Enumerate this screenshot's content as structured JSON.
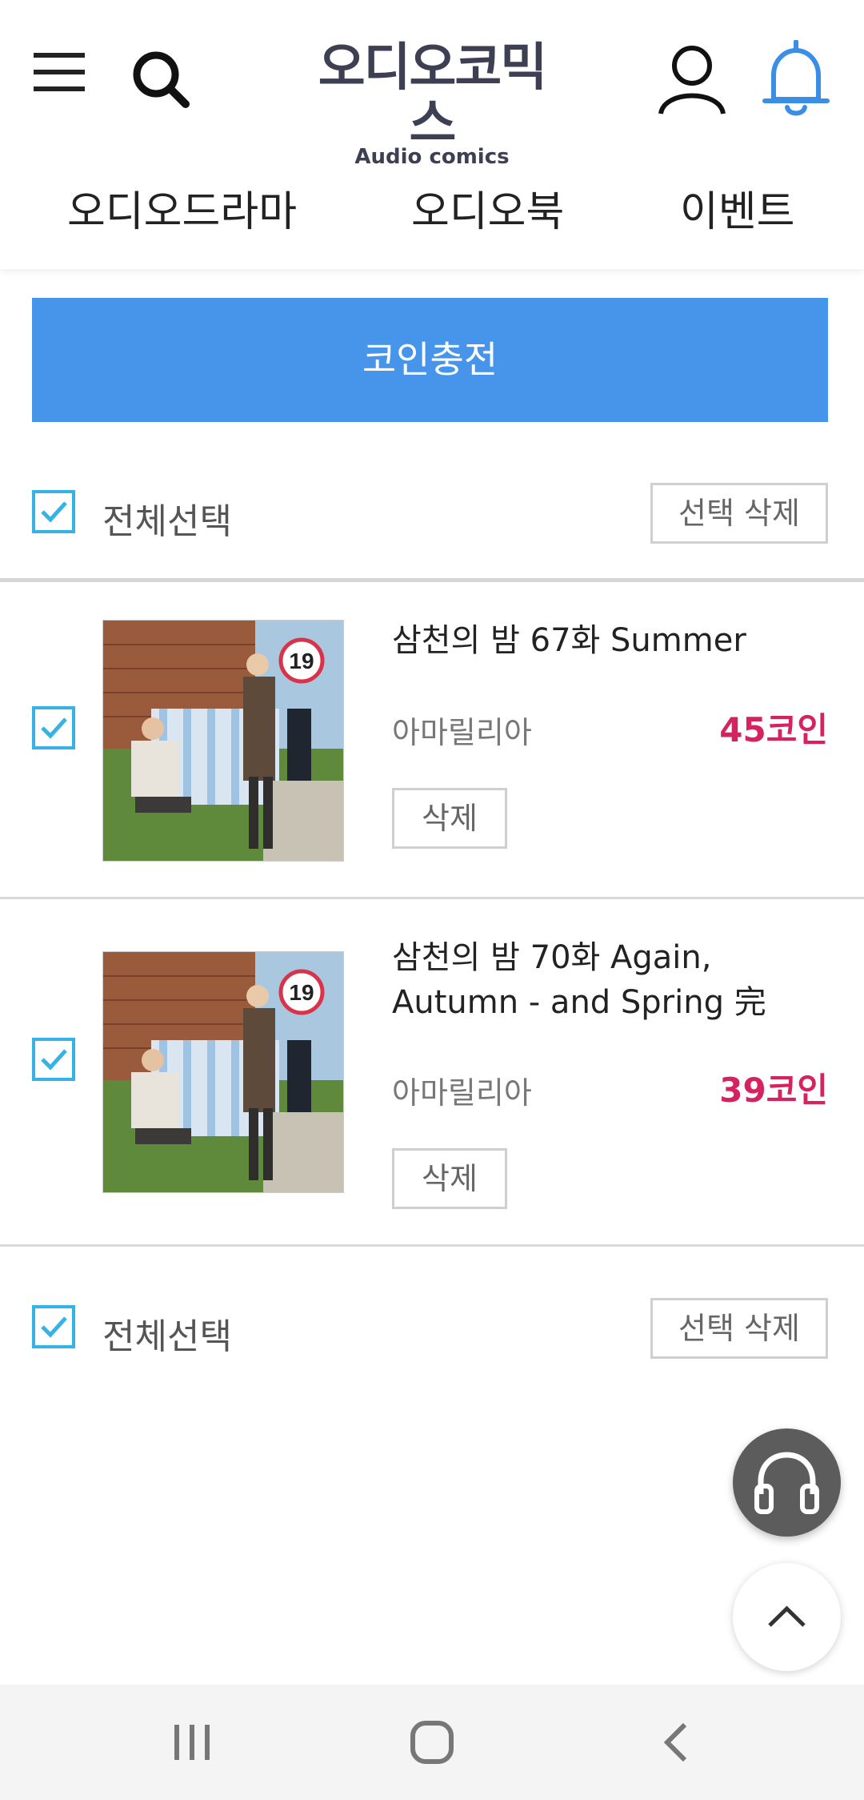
{
  "header": {
    "logo_main": "오디오코믹스",
    "logo_sub": "Audio comics",
    "tabs": [
      "오디오드라마",
      "오디오북",
      "이벤트"
    ]
  },
  "coin_button": "코인충전",
  "select_all": {
    "label": "전체선택",
    "delete_label": "선택 삭제"
  },
  "items": [
    {
      "title": "삼천의 밤 67화 Summer",
      "author": "아마릴리아",
      "price": "45코인",
      "delete": "삭제",
      "badge": "19"
    },
    {
      "title": "삼천의 밤 70화 Again, Autumn - and Spring 完",
      "author": "아마릴리아",
      "price": "39코인",
      "delete": "삭제",
      "badge": "19"
    }
  ],
  "colors": {
    "accent": "#4795ea",
    "checkbox": "#33b3e6",
    "price": "#d6225f",
    "bell": "#3b8ee6"
  },
  "icons": [
    "menu-icon",
    "search-icon",
    "user-icon",
    "bell-icon",
    "headphones-icon",
    "chevron-up-icon",
    "recent-apps-icon",
    "home-icon",
    "back-icon"
  ]
}
